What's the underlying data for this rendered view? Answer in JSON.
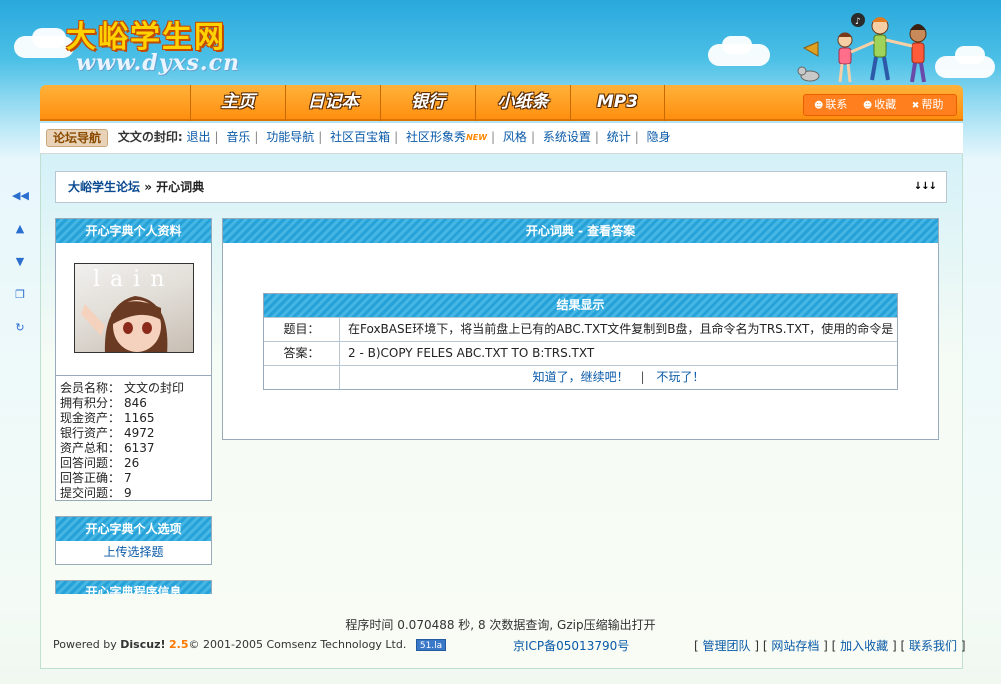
{
  "header": {
    "site_name": "大峪学生网",
    "site_url": "www.dyxs.cn"
  },
  "nav": {
    "items": [
      "主页",
      "日记本",
      "银行",
      "小纸条",
      "MP3"
    ],
    "right": {
      "contact": "联系",
      "favorite": "收藏",
      "help": "帮助"
    }
  },
  "subnav": {
    "tag": "论坛导航",
    "user": "文文の封印:",
    "links": [
      "退出",
      "音乐",
      "功能导航",
      "社区百宝箱",
      "社区形象秀",
      "风格",
      "系统设置",
      "统计",
      "隐身"
    ],
    "new_badge": "NEW"
  },
  "breadcrumb": {
    "forum": "大峪学生论坛",
    "sep": " » ",
    "current": "开心词典",
    "arrows": "↓↓↓"
  },
  "left": {
    "profile_title": "开心字典个人资料",
    "avatar_text": "lain",
    "stats": [
      {
        "label": "会员名称：",
        "value": "文文の封印"
      },
      {
        "label": "拥有积分：",
        "value": "846"
      },
      {
        "label": "现金资产：",
        "value": "1165"
      },
      {
        "label": "银行资产：",
        "value": "4972"
      },
      {
        "label": "资产总和：",
        "value": "6137"
      },
      {
        "label": "回答问题：",
        "value": "26"
      },
      {
        "label": "回答正确：",
        "value": "7"
      },
      {
        "label": "提交问题：",
        "value": "9"
      }
    ],
    "options_title": "开心字典个人选项",
    "options_link": "上传选择题",
    "program_title": "开心字典程序信息"
  },
  "main": {
    "title": "开心词典 - 查看答案",
    "result_title": "结果显示",
    "question_label": "题目：",
    "question_text": "在FoxBASE环境下，将当前盘上已有的ABC.TXT文件复制到B盘，且命令名为TRS.TXT，使用的命令是",
    "answer_label": "答案：",
    "answer_text": "2 - B)COPY FELES ABC.TXT TO B:TRS.TXT",
    "continue_link": "知道了，继续吧！",
    "action_sep": "|",
    "quit_link": "不玩了！"
  },
  "footer": {
    "time": "程序时间 0.070488 秒, 8 次数据查询, Gzip压缩输出打开",
    "powered_prefix": "Powered by ",
    "powered_brand": "Discuz!",
    "powered_version": "2.5",
    "copyright": "© 2001-2005 Comsenz Technology Ltd.",
    "badge": "51.la",
    "icp": "京ICP备05013790号",
    "links": [
      "管理团队",
      "网站存档",
      "加入收藏",
      "联系我们"
    ]
  },
  "colors": {
    "nav_orange": "#ff8f10",
    "header_blue": "#27a2d8",
    "link_blue": "#0a5aa8"
  }
}
